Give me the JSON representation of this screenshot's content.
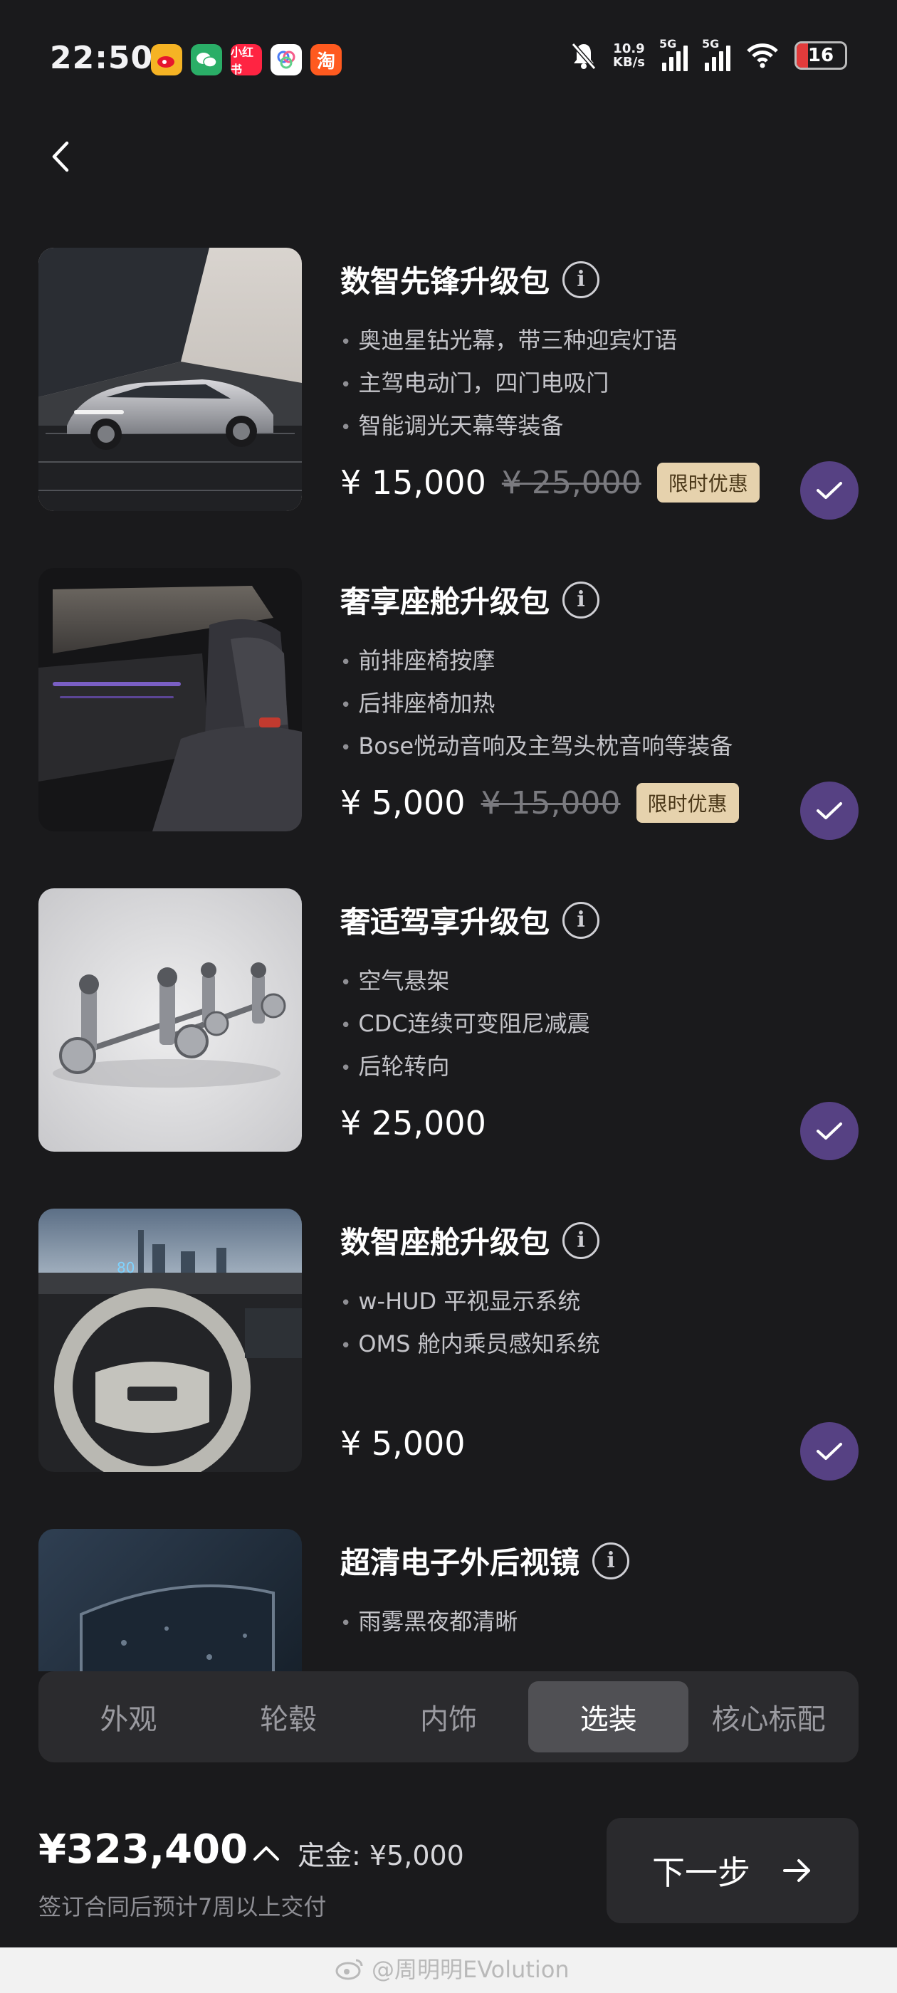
{
  "status": {
    "time": "22:50",
    "apps": [
      "weibo",
      "wechat",
      "小红书",
      "app",
      "淘"
    ],
    "net_speed_value": "10.9",
    "net_speed_unit": "KB/s",
    "sim1": "5G",
    "sim2": "5G",
    "battery": "16"
  },
  "packages": [
    {
      "title": "数智先锋升级包",
      "features": [
        "奥迪星钻光幕，带三种迎宾灯语",
        "主驾电动门，四门电吸门",
        "智能调光天幕等装备"
      ],
      "price": "¥ 15,000",
      "original_price": "¥ 25,000",
      "badge": "限时优惠"
    },
    {
      "title": "奢享座舱升级包",
      "features": [
        "前排座椅按摩",
        "后排座椅加热",
        "Bose悦动音响及主驾头枕音响等装备"
      ],
      "price": "¥ 5,000",
      "original_price": "¥ 15,000",
      "badge": "限时优惠"
    },
    {
      "title": "奢适驾享升级包",
      "features": [
        "空气悬架",
        "CDC连续可变阻尼减震",
        "后轮转向"
      ],
      "price": "¥ 25,000"
    },
    {
      "title": "数智座舱升级包",
      "features": [
        "w-HUD 平视显示系统",
        "OMS 舱内乘员感知系统"
      ],
      "price": "¥ 5,000"
    },
    {
      "title": "超清电子外后视镜",
      "features": [
        "雨雾黑夜都清晰"
      ]
    }
  ],
  "tabs": [
    "外观",
    "轮毂",
    "内饰",
    "选装",
    "核心标配"
  ],
  "active_tab": "选装",
  "summary": {
    "total": "¥323,400",
    "deposit": "定金: ¥5,000",
    "delivery_note": "签订合同后预计7周以上交付",
    "next_label": "下一步"
  },
  "watermark": "@周明明EVolution",
  "colors": {
    "background": "#1a1a1c",
    "check": "#564183",
    "promo_badge": "#e6d2ad",
    "active_tab": "#505054"
  }
}
